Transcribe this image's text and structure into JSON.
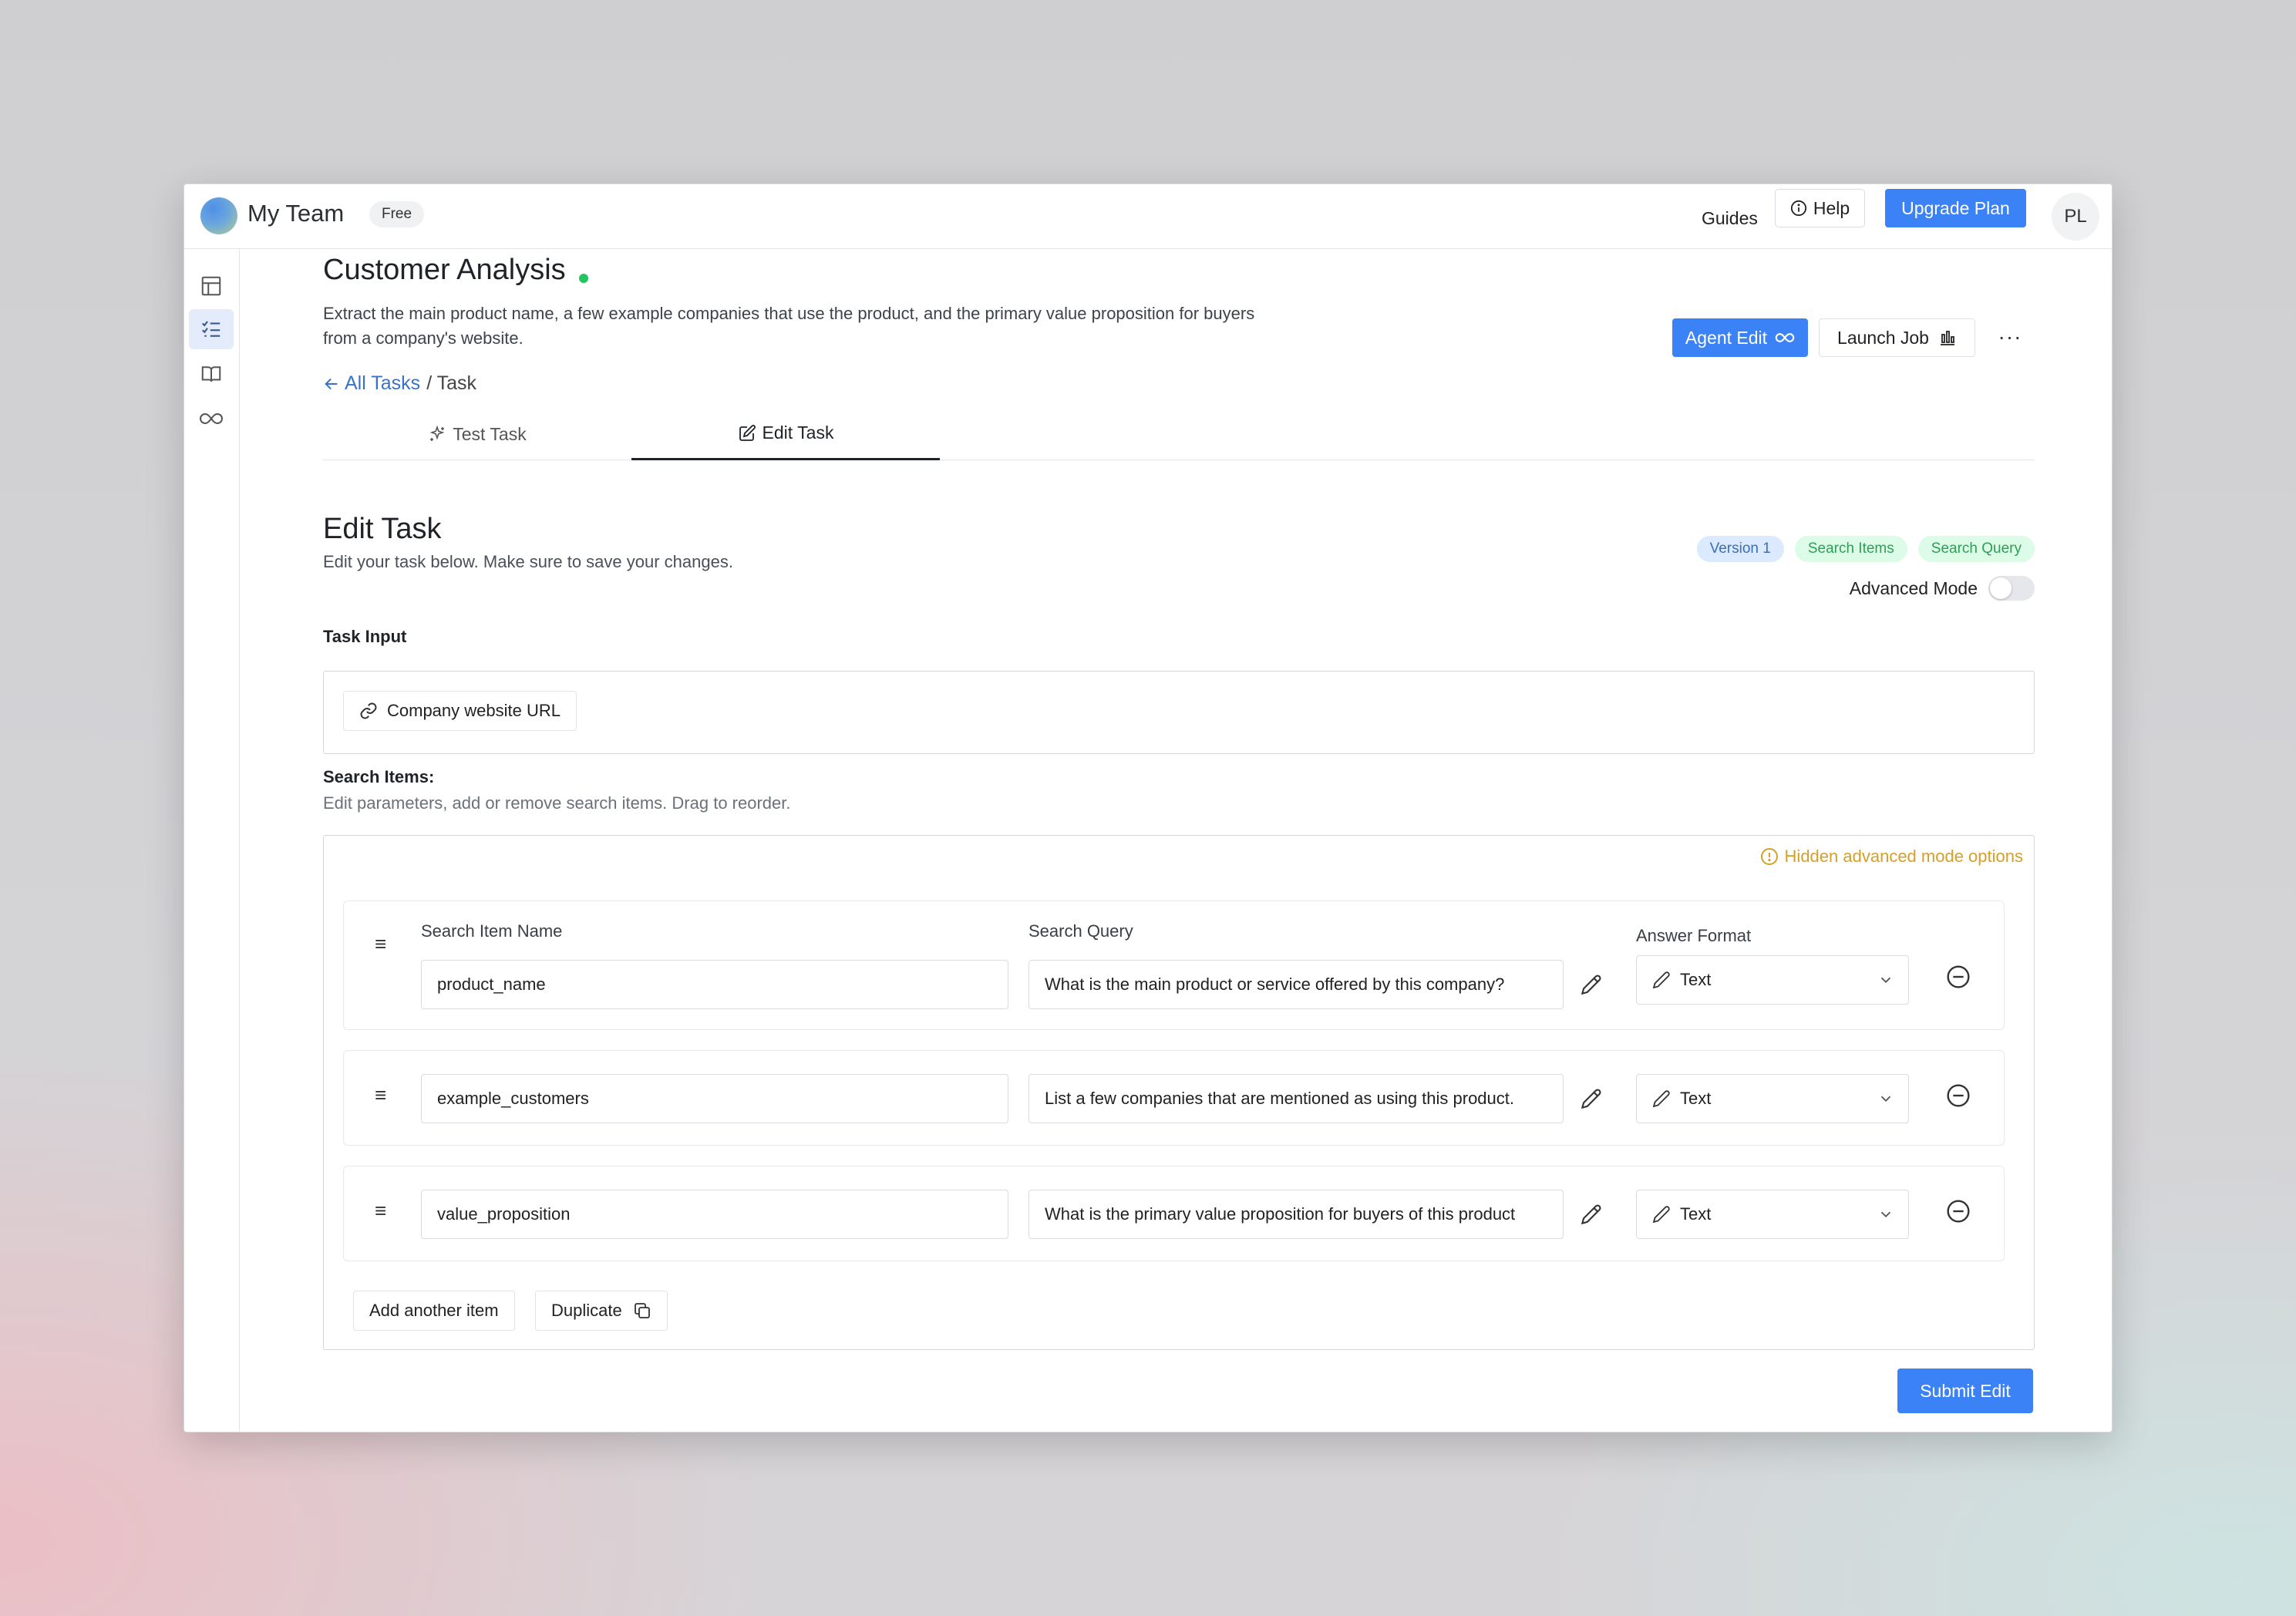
{
  "header": {
    "team_name": "My Team",
    "plan_badge": "Free",
    "guides_label": "Guides",
    "help_label": "Help",
    "upgrade_label": "Upgrade Plan",
    "avatar_initials": "PL"
  },
  "sidebar": {
    "items": [
      {
        "icon": "table-icon",
        "active": false
      },
      {
        "icon": "task-list-icon",
        "active": true
      },
      {
        "icon": "book-icon",
        "active": false
      },
      {
        "icon": "infinity-icon",
        "active": false
      }
    ]
  },
  "page": {
    "title": "Customer Analysis",
    "description": "Extract the main product name, a few example companies that use the product, and the primary value proposition for buyers from a company's website.",
    "agent_edit_label": "Agent Edit",
    "launch_job_label": "Launch Job",
    "more_label": "···",
    "breadcrumb": {
      "back_label": "All Tasks",
      "current": "/ Task"
    },
    "tabs": [
      {
        "label": "Test Task",
        "active": false
      },
      {
        "label": "Edit Task",
        "active": true
      }
    ]
  },
  "edit": {
    "title": "Edit Task",
    "subtitle": "Edit your task below. Make sure to save your changes.",
    "badges": [
      "Version 1",
      "Search Items",
      "Search Query"
    ],
    "advanced_mode_label": "Advanced Mode",
    "advanced_mode_on": false,
    "task_input_label": "Task Input",
    "task_input_chip": "Company website URL",
    "search_items_label": "Search Items:",
    "search_items_sub": "Edit parameters, add or remove search items. Drag to reorder.",
    "hidden_options": "Hidden advanced mode options",
    "columns": {
      "name": "Search Item Name",
      "query": "Search Query",
      "format": "Answer Format"
    },
    "rows": [
      {
        "name": "product_name",
        "query": "What is the main product or service offered by this company?",
        "format": "Text"
      },
      {
        "name": "example_customers",
        "query": "List a few companies that are mentioned as using this product.",
        "format": "Text"
      },
      {
        "name": "value_proposition",
        "query": "What is the primary value proposition for buyers of this product",
        "format": "Text"
      }
    ],
    "add_label": "Add another item",
    "duplicate_label": "Duplicate",
    "submit_label": "Submit Edit"
  },
  "colors": {
    "accent": "#3b82f6",
    "status": "#22c55e",
    "warning": "#d4a02a"
  }
}
